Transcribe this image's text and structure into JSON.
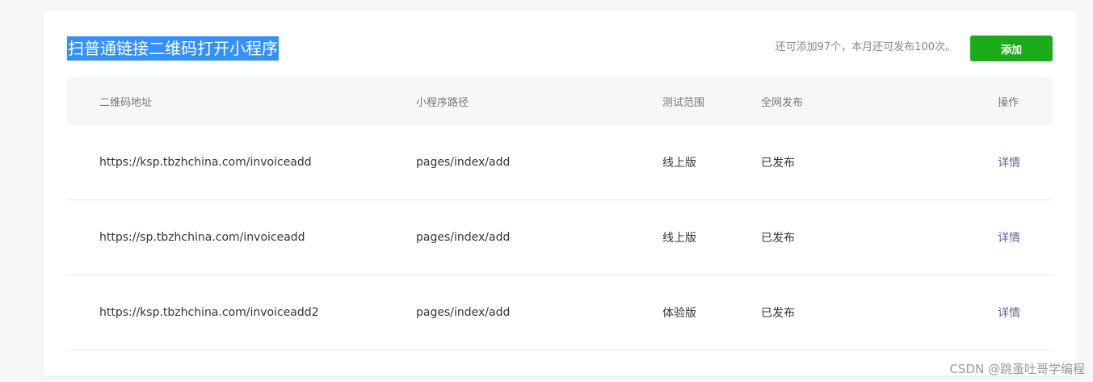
{
  "header": {
    "title": "扫普通链接二维码打开小程序",
    "quota_text": "还可添加97个，本月还可发布100次。",
    "add_label": "添加"
  },
  "table": {
    "columns": [
      "二维码地址",
      "小程序路径",
      "测试范围",
      "全网发布",
      "操作"
    ],
    "rows": [
      {
        "url": "https://ksp.tbzhchina.com/invoiceadd",
        "path": "pages/index/add",
        "scope": "线上版",
        "publish": "已发布",
        "action": "详情"
      },
      {
        "url": "https://sp.tbzhchina.com/invoiceadd",
        "path": "pages/index/add",
        "scope": "线上版",
        "publish": "已发布",
        "action": "详情"
      },
      {
        "url": "https://ksp.tbzhchina.com/invoiceadd2",
        "path": "pages/index/add",
        "scope": "体验版",
        "publish": "已发布",
        "action": "详情"
      }
    ]
  },
  "watermark": "CSDN @跳蚤吐哥学编程",
  "colors": {
    "primary_button": "#1aad19",
    "link": "#576b95",
    "title_highlight": "#3390ff",
    "header_bg": "#f6f7f9"
  }
}
